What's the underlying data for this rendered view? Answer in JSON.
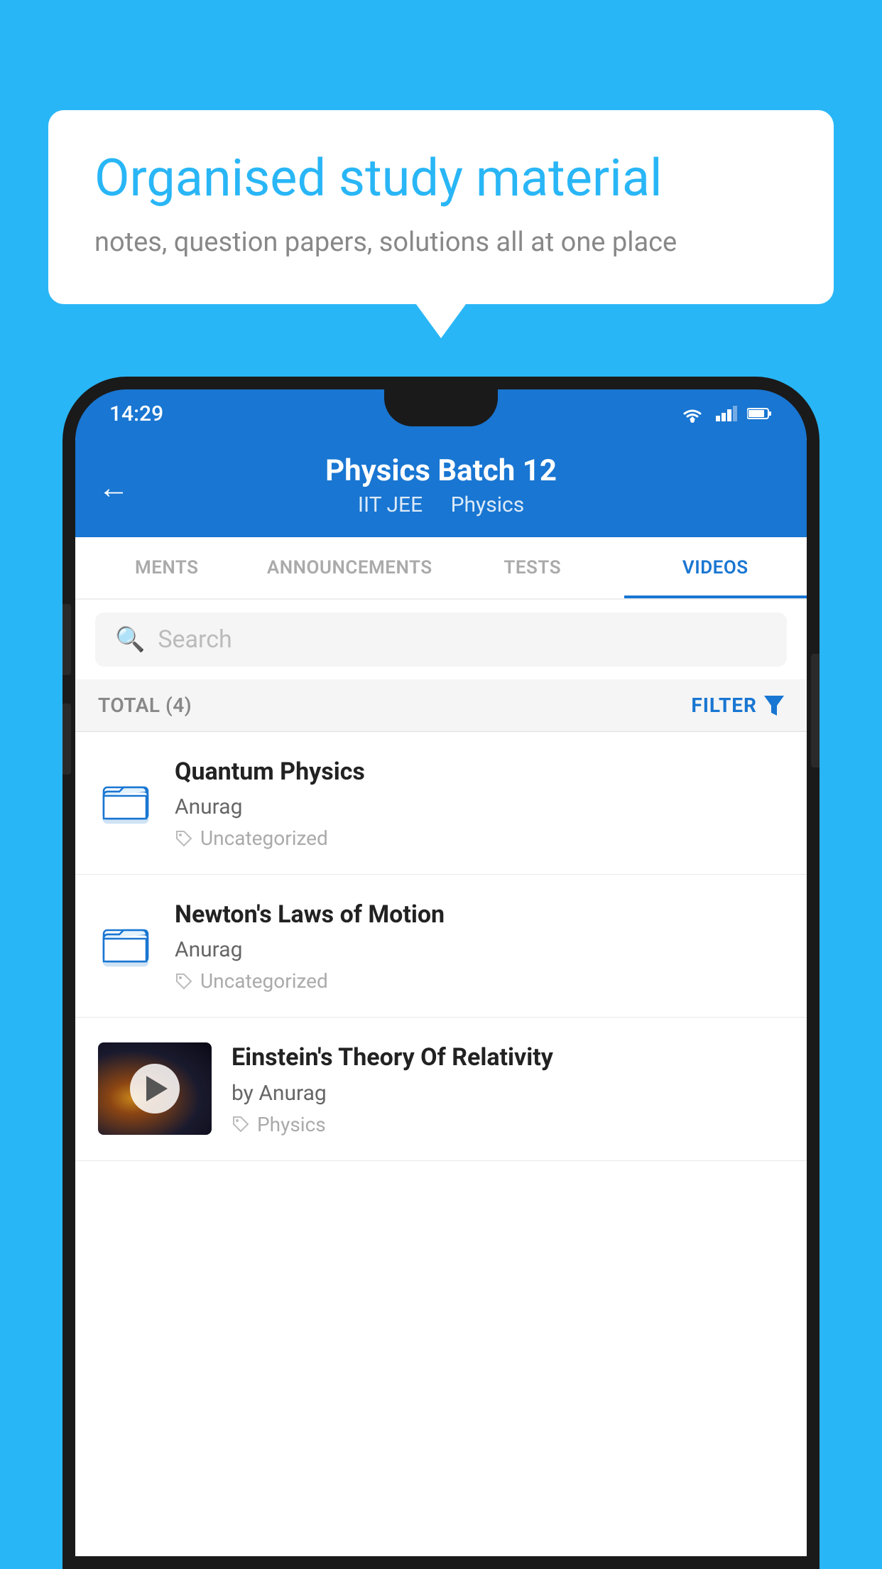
{
  "page": {
    "background_color": "#29B6F6"
  },
  "speech_bubble": {
    "title": "Organised study material",
    "subtitle": "notes, question papers, solutions all at one place"
  },
  "status_bar": {
    "time": "14:29"
  },
  "app_header": {
    "title": "Physics Batch 12",
    "category1": "IIT JEE",
    "category2": "Physics",
    "back_label": "←"
  },
  "tabs": [
    {
      "label": "MENTS",
      "active": false
    },
    {
      "label": "ANNOUNCEMENTS",
      "active": false
    },
    {
      "label": "TESTS",
      "active": false
    },
    {
      "label": "VIDEOS",
      "active": true
    }
  ],
  "search": {
    "placeholder": "Search"
  },
  "filter_bar": {
    "total_label": "TOTAL (4)",
    "filter_label": "FILTER"
  },
  "videos": [
    {
      "title": "Quantum Physics",
      "author": "Anurag",
      "tag": "Uncategorized",
      "has_thumbnail": false
    },
    {
      "title": "Newton's Laws of Motion",
      "author": "Anurag",
      "tag": "Uncategorized",
      "has_thumbnail": false
    },
    {
      "title": "Einstein's Theory Of Relativity",
      "author": "by Anurag",
      "tag": "Physics",
      "has_thumbnail": true
    }
  ]
}
